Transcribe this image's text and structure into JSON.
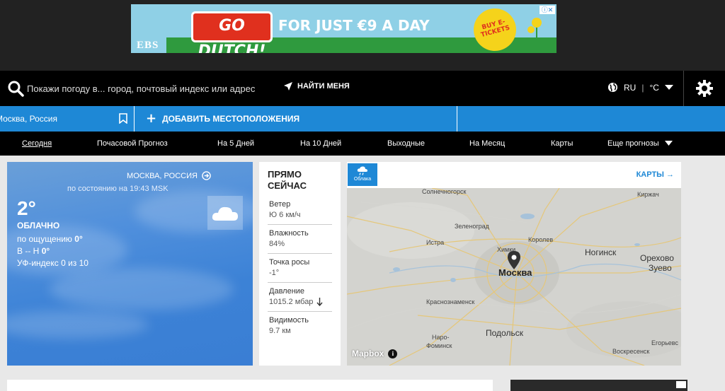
{
  "ad": {
    "brand": "EBS",
    "bus_text": "GO DUTCH!",
    "headline": "FOR JUST €9 A DAY",
    "badge": "BUY E-TICKETS"
  },
  "search": {
    "placeholder": "Покажи погоду в... город, почтовый индекс или адрес",
    "find_me": "НАЙТИ МЕНЯ",
    "language": "RU",
    "unit": "°C"
  },
  "location_bar": {
    "current": "Москва, Россия",
    "add_location": "ДОБАВИТЬ МЕСТОПОЛОЖЕНИЯ"
  },
  "tabs": [
    {
      "label": "Сегодня"
    },
    {
      "label": "Почасовой Прогноз"
    },
    {
      "label": "На 5 Дней"
    },
    {
      "label": "На 10 Дней"
    },
    {
      "label": "Выходные"
    },
    {
      "label": "На Месяц"
    },
    {
      "label": "Карты"
    },
    {
      "label": "Еще прогнозы"
    }
  ],
  "current": {
    "city": "МОСКВА, РОССИЯ",
    "updated": "по состоянию на 19:43 MSK",
    "temp": "2°",
    "condition": "ОБЛАЧНО",
    "feels_label": "по ощущению",
    "feels_value": "0°",
    "wind_label": "В -- Н",
    "wind_value": "0°",
    "uv": "УФ-индекс 0 из 10"
  },
  "right_now": {
    "title": "ПРЯМО СЕЙЧАС",
    "items": [
      {
        "label": "Ветер",
        "value": "Ю 6 км/ч"
      },
      {
        "label": "Влажность",
        "value": "84%"
      },
      {
        "label": "Точка росы",
        "value": "-1°"
      },
      {
        "label": "Давление",
        "value": "1015.2 мбар"
      },
      {
        "label": "Видимость",
        "value": "9.7 км"
      }
    ]
  },
  "map": {
    "layer": "Облака",
    "link": "КАРТЫ →",
    "attribution": "Mapbox",
    "places": {
      "solnechnogorsk": "Солнечногорск",
      "zelenograd": "Зеленоград",
      "istra": "Истра",
      "khimki": "Химки",
      "korolev": "Королев",
      "moskva": "Москва",
      "noginsk": "Ногинск",
      "orekhovo": "Орехово",
      "zuevo": "Зуево",
      "kirzhach": "Киржач",
      "krasnoznamensk": "Краснознаменск",
      "podolsk": "Подольск",
      "naro": "Наро-",
      "fominsk": "Фоминск",
      "egorevsk": "Егорьевс",
      "voskresensk": "Воскресенск"
    }
  }
}
